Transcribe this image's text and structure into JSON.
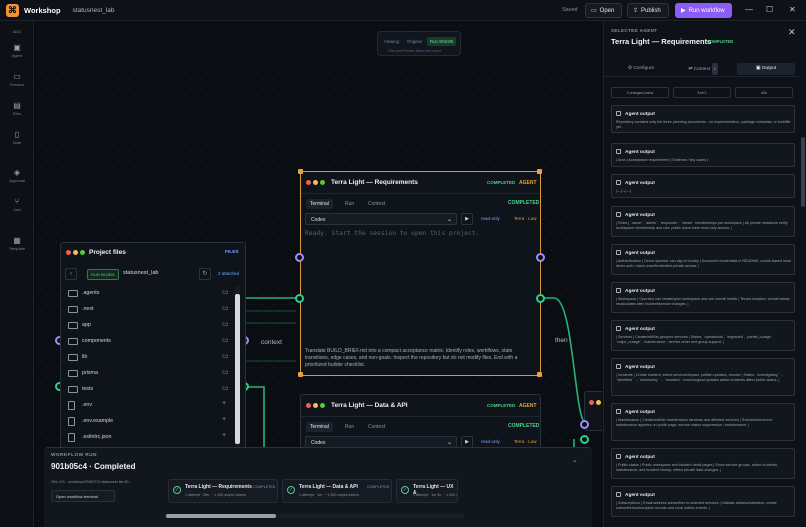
{
  "app": {
    "name": "Workshop",
    "project": "statusnest_lab",
    "saved": "Saved",
    "open_label": "Open",
    "publish_label": "Publish",
    "run_label": "Run workflow"
  },
  "rail": {
    "top_label": "ADD",
    "items": [
      {
        "label": "Agent",
        "icon": "agent-icon"
      },
      {
        "label": "Preview",
        "icon": "monitor-icon"
      },
      {
        "label": "Files",
        "icon": "files-icon"
      },
      {
        "label": "Note",
        "icon": "note-icon"
      },
      {
        "label": "Approval",
        "icon": "shield-check-icon"
      },
      {
        "label": "Join",
        "icon": "git-merge-icon"
      },
      {
        "label": "Template",
        "icon": "template-icon"
      }
    ]
  },
  "viewtabs": {
    "tabs": [
      "Viewing",
      "Original",
      "Run 901b05"
    ],
    "active": 2,
    "note": "Files and Preview follow this output"
  },
  "edge_labels": {
    "context": "context",
    "then": "then"
  },
  "cards": [
    {
      "title": "Terra Light — Requirements",
      "status": "COMPLETED",
      "role": "AGENT",
      "tabs": [
        "Terminal",
        "Run",
        "Context"
      ],
      "completed": "COMPLETED",
      "model": "Codex",
      "access": "read-only",
      "level": "Terra · Low",
      "terminal": "Ready. Start the session to open this project.",
      "description": "Translate BUILD_BRIEF.md into a compact acceptance matrix. Identify roles, workflows, state transitions, edge cases, and non-goals. Inspect the repository but do not modify files. End with a prioritized builder checklist."
    },
    {
      "title": "Terra Light — Data & API",
      "status": "COMPLETED",
      "role": "AGENT",
      "tabs": [
        "Terminal",
        "Run",
        "Context"
      ],
      "completed": "COMPLETED",
      "model": "Codex",
      "access": "read-only",
      "level": "Terra · Low"
    }
  ],
  "files": {
    "title": "Project files",
    "label": "FILES",
    "pill": "RUN 901B05",
    "path": "statusnest_lab",
    "attached": "2 attached",
    "entries": [
      ".agents",
      ".next",
      "app",
      "components",
      "lib",
      "prisma",
      "tests",
      ".env",
      ".env.example",
      ".eslintrc.json"
    ]
  },
  "workflow_run": {
    "label": "WORKFLOW RUN",
    "title": "901b05c4 · Completed",
    "meta": "20m 47s · workshop/20260719 statusnest lab 90…",
    "terminal_label": "Open workflow terminal",
    "agents": [
      {
        "name": "Terra Light — Requirements",
        "status": "COMPLETED",
        "sub": "1 attempt · 28s · ~1,150 output tokens"
      },
      {
        "name": "Terra Light — Data & API",
        "status": "COMPLETED",
        "sub": "1 attempt · 1m · ~1,550 output tokens"
      },
      {
        "name": "Terra Light — UX &",
        "status": "",
        "sub": "1 attempt · 1m 3s · ~1,200 output tokens"
      }
    ]
  },
  "panel": {
    "label": "SELECTED AGENT",
    "title": "Terra Light — Requirements",
    "status": "COMPLETED",
    "tabs": [
      {
        "label": "Configure"
      },
      {
        "label": "Context",
        "badge": "0"
      },
      {
        "label": "Output"
      }
    ],
    "active_tab": 2,
    "filters": [
      "0 changed paths",
      "Exit 0",
      "40s"
    ],
    "outputs": [
      {
        "head": "Agent output",
        "body": "Repository contains only the three planning documents - no implementation, package metadata, or buildfile yet."
      },
      {
        "head": "Agent output",
        "body": "| Area | Acceptance requirement | Evidence / key cases |"
      },
      {
        "head": "Agent output",
        "body": "|---|---|---|"
      },
      {
        "head": "Agent output",
        "body": "| Roles | `owner`, `admin`, `responder`, `viewer` memberships per workspace | All private mutations verify workspace membership and role; public users have read-only access. |"
      },
      {
        "head": "Agent output",
        "body": "| Authentication | Demo operator can sign in locally | Document credentials in README; cookie-based local demo auth; reject unauthenticated private access. |"
      },
      {
        "head": "Agent output",
        "body": "| Workspace | Operator can create/open workspace and see overall health | Tenant isolation; overall status recalculates after incident/service changes. |"
      },
      {
        "head": "Agent output",
        "body": "| Services | Create/edit/list grouped services | States: `operational`, `degraded`, `partial_outage`, `major_outage`, `maintenance`; service order and group support. |"
      },
      {
        "head": "Agent output",
        "body": "| Incidents | Create incident, select services/impact, publish updates, resolve | States: `investigating` → `identified` → `monitoring` → `resolved`; chronological updates active incidents affect public status. |"
      },
      {
        "head": "Agent output",
        "body": "| Maintenance | Create/edit/list maintenance windows and affected services | Scheduled/current maintenance appears on public page; service status suppression / maintenance. |"
      },
      {
        "head": "Agent output",
        "body": "| Public status | Public workspace and incident detail pages | Show service groups, active incidents, maintenance, and incident history; reflect private data changes. |"
      },
      {
        "head": "Agent output",
        "body": "| Subscriptions | Email address subscribes to selected services | Validate address/selection; create subscriber/subscription records and local outbox events. |"
      }
    ]
  },
  "colors": {
    "accent": "#8b5cf6",
    "selected": "#d89a3a",
    "success": "#4fd18b",
    "wire": "#2fcf89"
  }
}
